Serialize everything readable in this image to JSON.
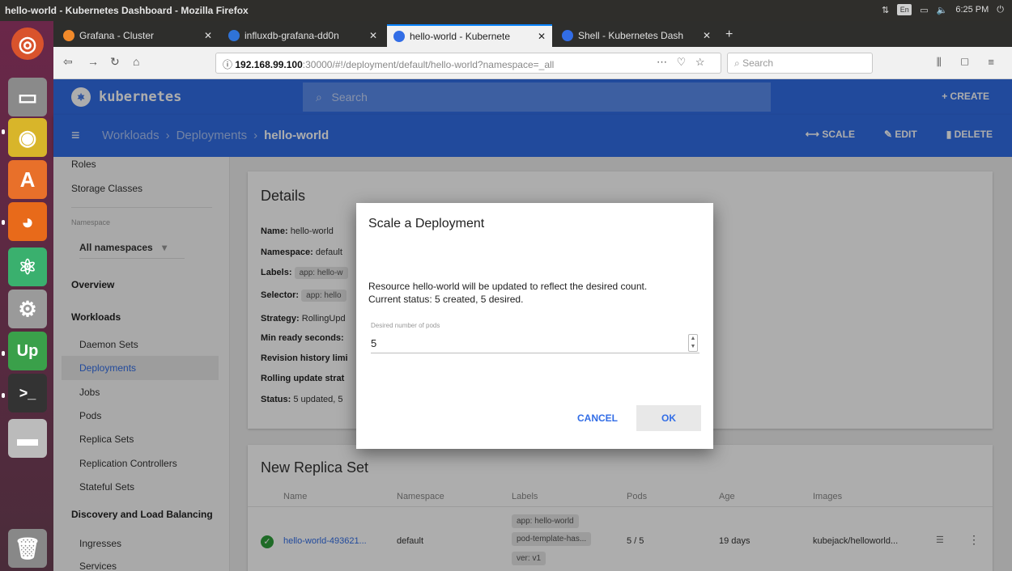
{
  "os": {
    "window_title": "hello-world - Kubernetes Dashboard - Mozilla Firefox",
    "keyboard": "En",
    "clock": "6:25 PM"
  },
  "browser": {
    "tabs": [
      {
        "label": "Grafana - Cluster",
        "active": false
      },
      {
        "label": "influxdb-grafana-dd0n",
        "active": false
      },
      {
        "label": "hello-world - Kubernete",
        "active": true
      },
      {
        "label": "Shell - Kubernetes Dash",
        "active": false
      }
    ],
    "url_host": "192.168.99.100",
    "url_path": ":30000/#!/deployment/default/hello-world?namespace=_all",
    "search_placeholder": "Search"
  },
  "k8s": {
    "brand": "kubernetes",
    "search_placeholder": "Search",
    "create_label": "+ CREATE",
    "breadcrumbs": [
      "Workloads",
      "Deployments",
      "hello-world"
    ],
    "actions": {
      "scale": "SCALE",
      "edit": "EDIT",
      "delete": "DELETE"
    }
  },
  "sidebar": {
    "roles": "Roles",
    "storage_classes": "Storage Classes",
    "namespace_label": "Namespace",
    "namespace_value": "All namespaces",
    "overview": "Overview",
    "workloads": "Workloads",
    "items": [
      "Daemon Sets",
      "Deployments",
      "Jobs",
      "Pods",
      "Replica Sets",
      "Replication Controllers",
      "Stateful Sets"
    ],
    "discovery": "Discovery and Load Balancing",
    "discovery_items": [
      "Ingresses",
      "Services"
    ]
  },
  "details": {
    "title": "Details",
    "name_label": "Name:",
    "name_value": "hello-world",
    "namespace_label": "Namespace:",
    "namespace_value": "default",
    "labels_label": "Labels:",
    "labels_value": "app: hello-w",
    "selector_label": "Selector:",
    "selector_value": "app: hello",
    "strategy_label": "Strategy:",
    "strategy_value": "RollingUpd",
    "min_ready_label": "Min ready seconds:",
    "revision_label": "Revision history limi",
    "rolling_label": "Rolling update strat",
    "status_label": "Status:",
    "status_value": "5 updated, 5"
  },
  "replica_set": {
    "title": "New Replica Set",
    "columns": [
      "Name",
      "Namespace",
      "Labels",
      "Pods",
      "Age",
      "Images"
    ],
    "row": {
      "name": "hello-world-493621...",
      "namespace": "default",
      "labels": [
        "app: hello-world",
        "pod-template-has...",
        "ver: v1"
      ],
      "pods": "5 / 5",
      "age": "19 days",
      "image": "kubejack/helloworld..."
    }
  },
  "dialog": {
    "title": "Scale a Deployment",
    "message_line1": "Resource hello-world will be updated to reflect the desired count.",
    "message_line2": "Current status: 5 created, 5 desired.",
    "input_label": "Desired number of pods",
    "input_value": "5",
    "cancel": "CANCEL",
    "ok": "OK"
  }
}
